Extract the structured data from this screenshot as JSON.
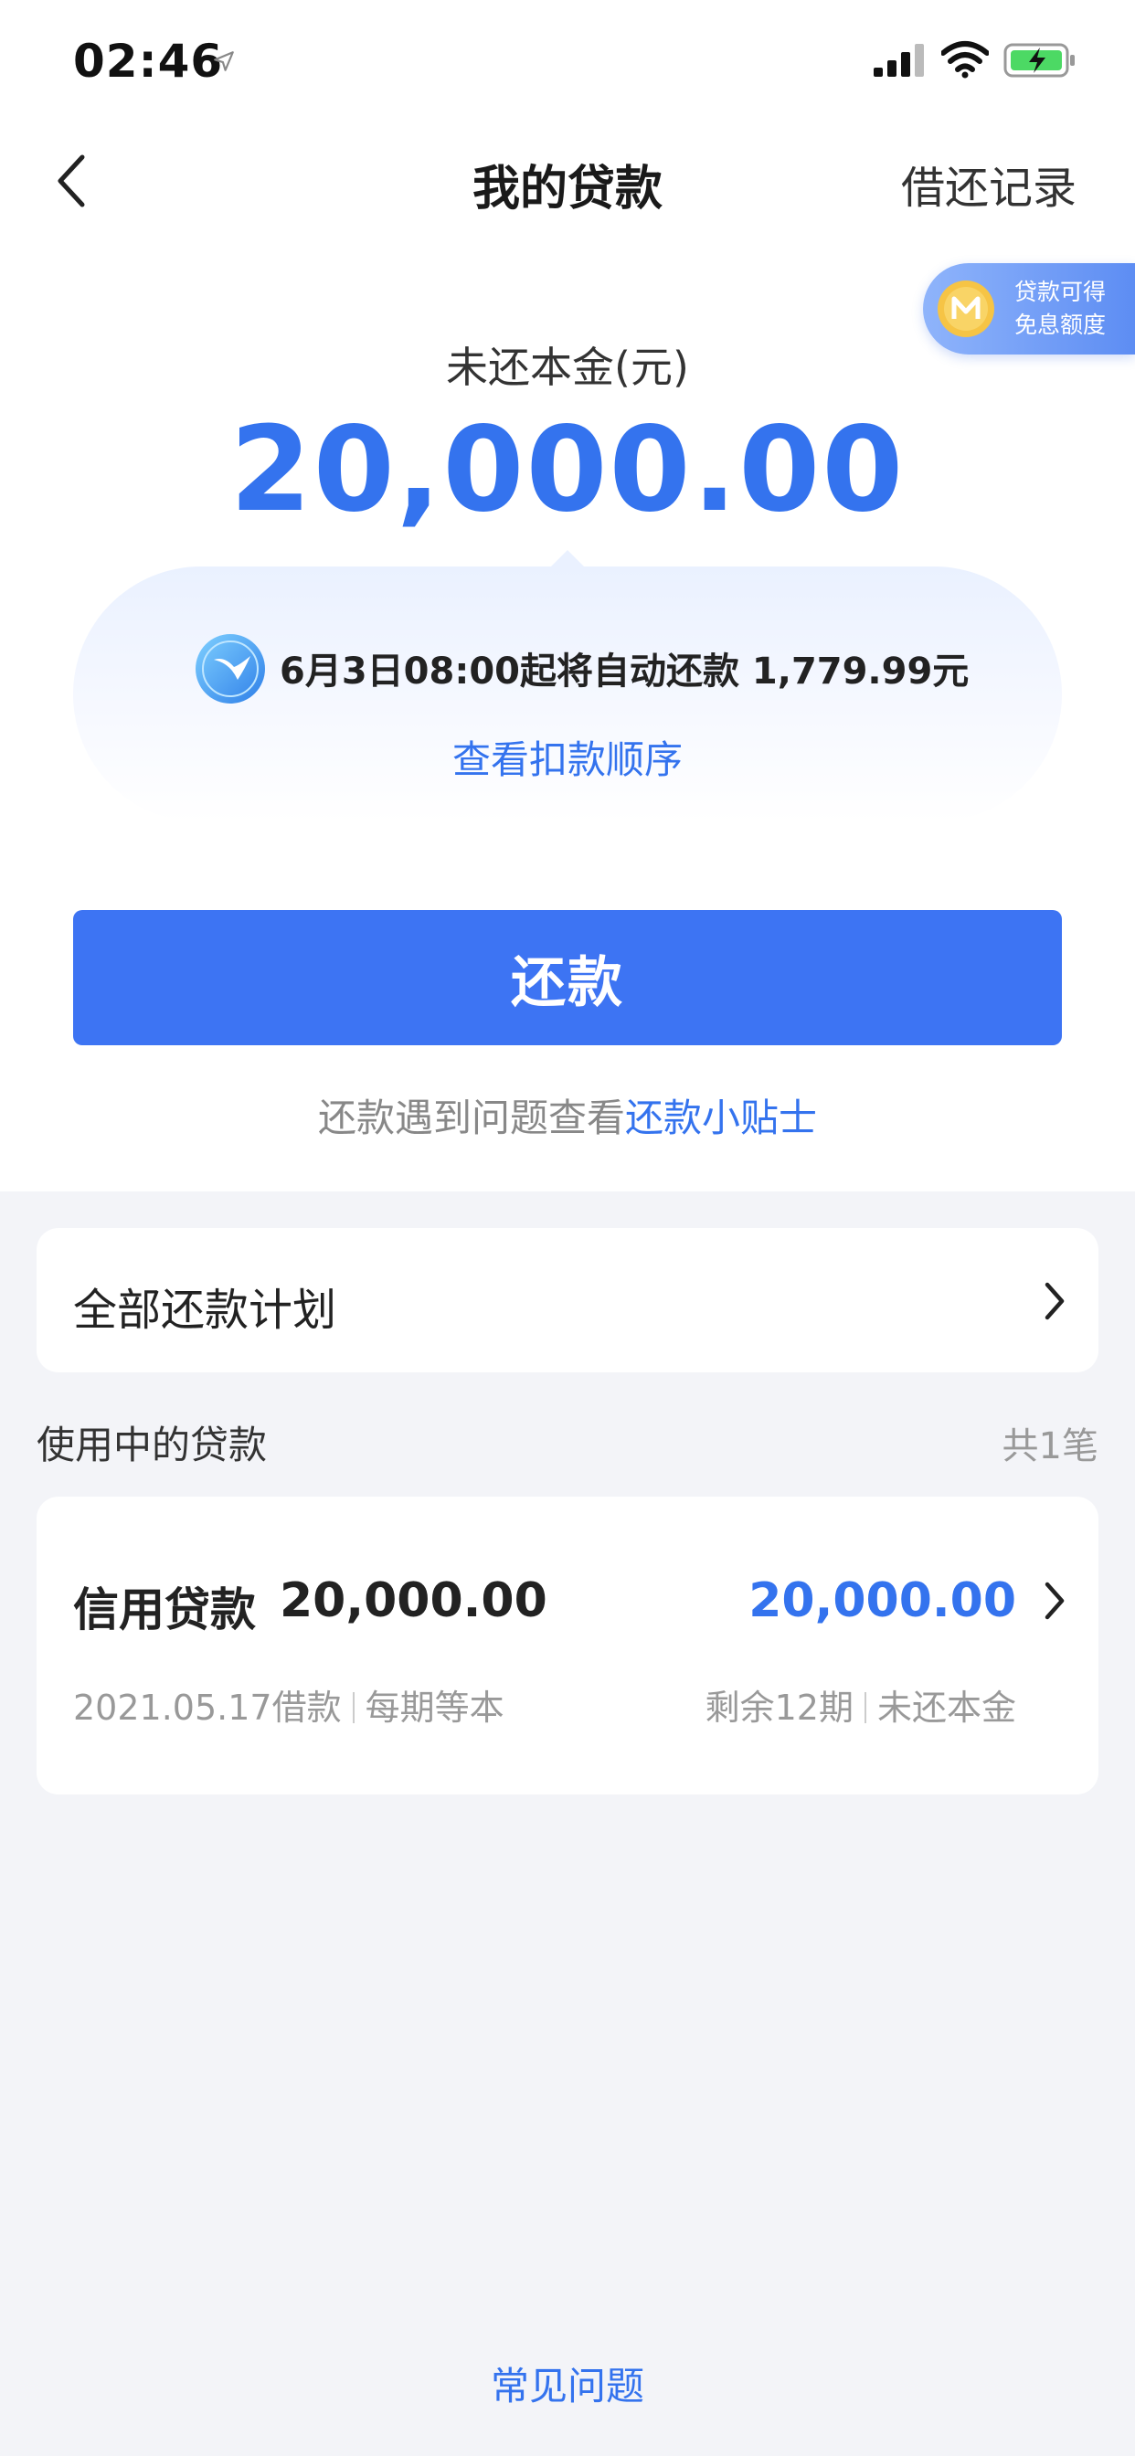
{
  "status_bar": {
    "time": "02:46",
    "icons": [
      "location-arrow-icon",
      "cellular-signal-icon",
      "wifi-icon",
      "battery-charging-icon"
    ]
  },
  "nav": {
    "title": "我的贷款",
    "right_action": "借还记录",
    "back_icon": "chevron-left-icon"
  },
  "promo": {
    "line1": "贷款可得",
    "line2": "免息额度",
    "icon": "coin-icon"
  },
  "principal": {
    "label": "未还本金(元)",
    "amount": "20,000.00"
  },
  "auto_repay": {
    "icon": "bird-badge-icon",
    "text": "6月3日08:00起将自动还款 1,779.99元",
    "link": "查看扣款顺序"
  },
  "repay_button": {
    "label": "还款"
  },
  "help": {
    "prefix": "还款遇到问题查看",
    "link": "还款小贴士"
  },
  "plan": {
    "label": "全部还款计划"
  },
  "active_loans": {
    "title": "使用中的贷款",
    "count": "共1笔",
    "items": [
      {
        "name": "信用贷款",
        "amount": "20,000.00",
        "remaining_amount": "20,000.00",
        "date": "2021.05.17借款",
        "method": "每期等本",
        "periods": "剩余12期",
        "remaining_label": "未还本金"
      }
    ]
  },
  "faq": {
    "label": "常见问题"
  },
  "colors": {
    "accent": "#3473ee",
    "button": "#3d74f3",
    "background": "#f3f4f8"
  }
}
